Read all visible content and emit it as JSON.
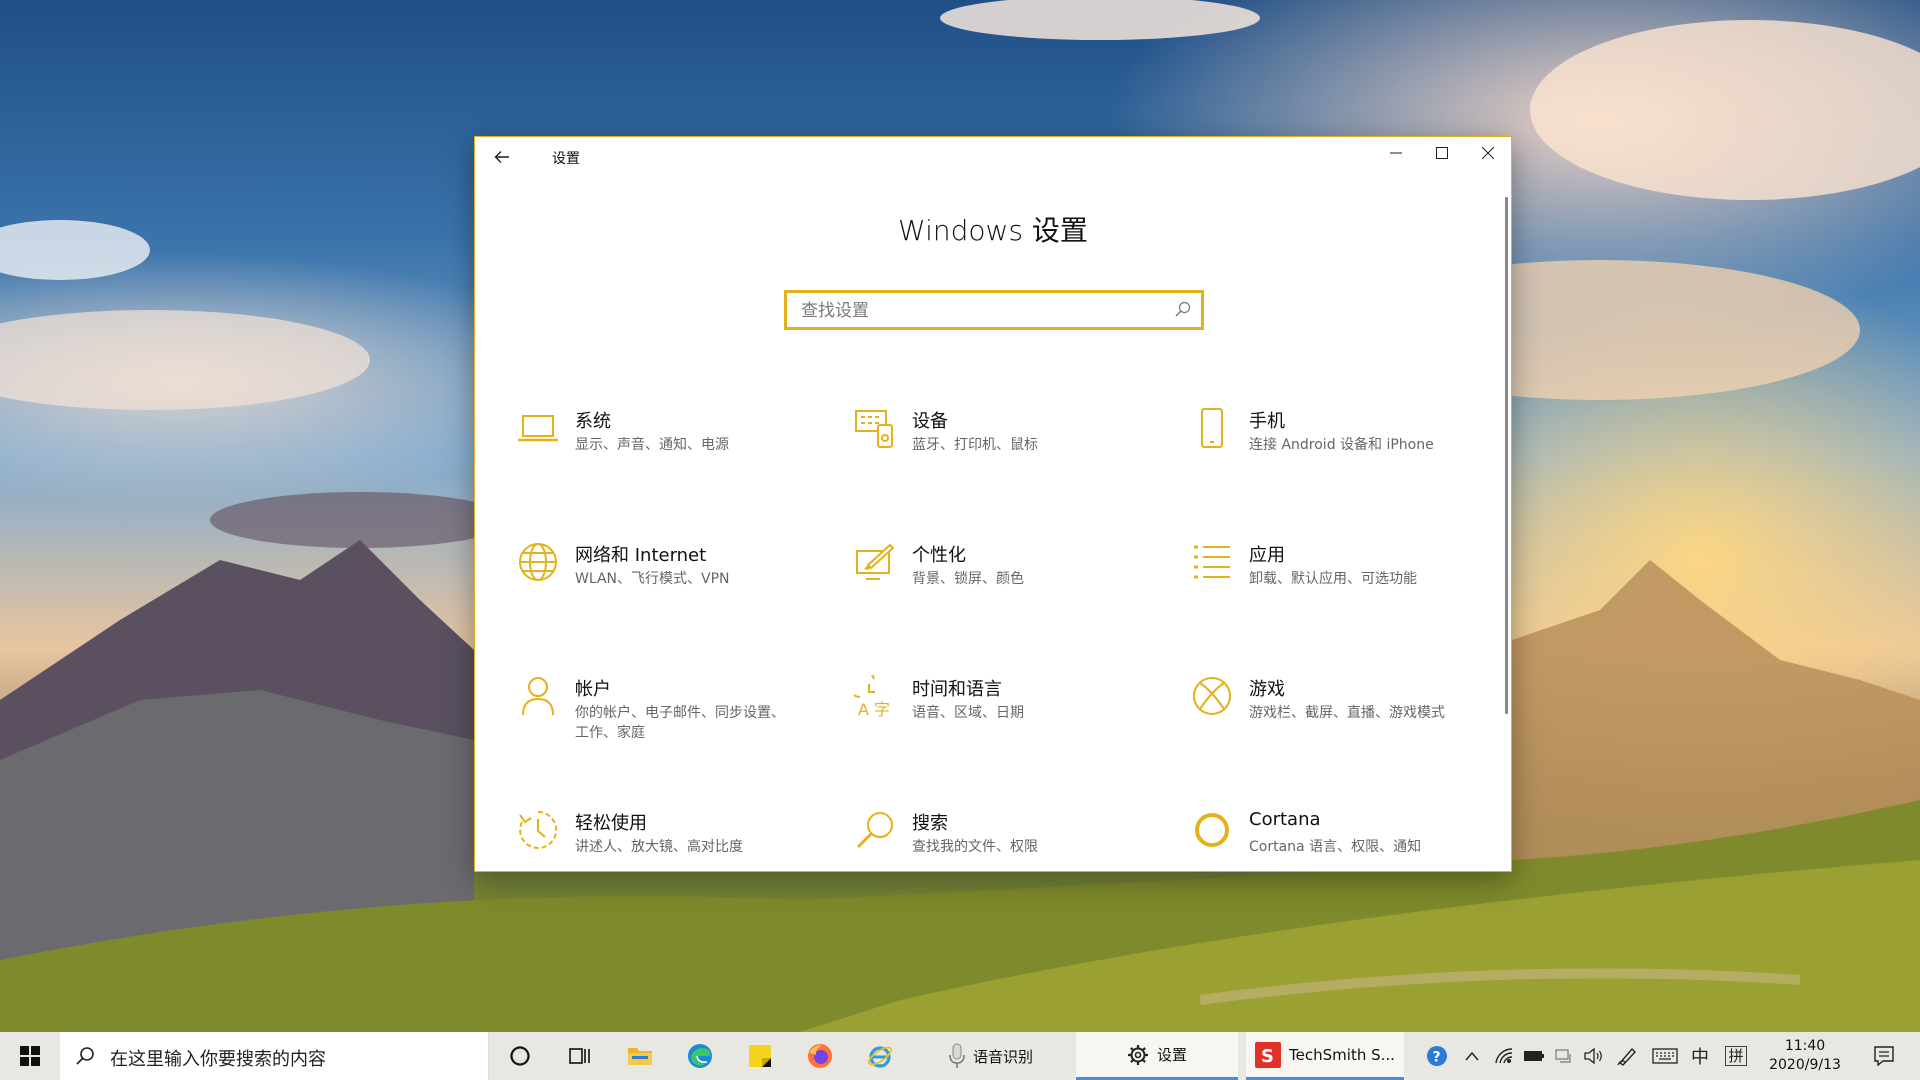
{
  "window": {
    "title": "设置",
    "heading": "Windows 设置",
    "search_placeholder": "查找设置",
    "accent": "#e3b21a"
  },
  "categories": [
    {
      "title": "系统",
      "desc": "显示、声音、通知、电源",
      "icon": "laptop-icon"
    },
    {
      "title": "设备",
      "desc": "蓝牙、打印机、鼠标",
      "icon": "devices-icon"
    },
    {
      "title": "手机",
      "desc": "连接 Android 设备和 iPhone",
      "icon": "phone-icon"
    },
    {
      "title": "网络和 Internet",
      "desc": "WLAN、飞行模式、VPN",
      "icon": "globe-icon"
    },
    {
      "title": "个性化",
      "desc": "背景、锁屏、颜色",
      "icon": "personalization-icon"
    },
    {
      "title": "应用",
      "desc": "卸载、默认应用、可选功能",
      "icon": "apps-list-icon"
    },
    {
      "title": "帐户",
      "desc": "你的帐户、电子邮件、同步设置、工作、家庭",
      "icon": "person-icon"
    },
    {
      "title": "时间和语言",
      "desc": "语音、区域、日期",
      "icon": "time-language-icon"
    },
    {
      "title": "游戏",
      "desc": "游戏栏、截屏、直播、游戏模式",
      "icon": "xbox-icon"
    },
    {
      "title": "轻松使用",
      "desc": "讲述人、放大镜、高对比度",
      "icon": "ease-of-access-icon"
    },
    {
      "title": "搜索",
      "desc": "查找我的文件、权限",
      "icon": "search-icon"
    },
    {
      "title": "Cortana",
      "desc": "Cortana 语言、权限、通知",
      "icon": "cortana-icon"
    }
  ],
  "taskbar": {
    "search_text": "在这里输入你要搜索的内容",
    "apps": [
      {
        "label": "语音识别"
      },
      {
        "label": "设置"
      },
      {
        "label": "TechSmith S..."
      }
    ],
    "ime_lang": "中",
    "ime_mode": "拼",
    "time": "11:40",
    "date": "2020/9/13"
  }
}
